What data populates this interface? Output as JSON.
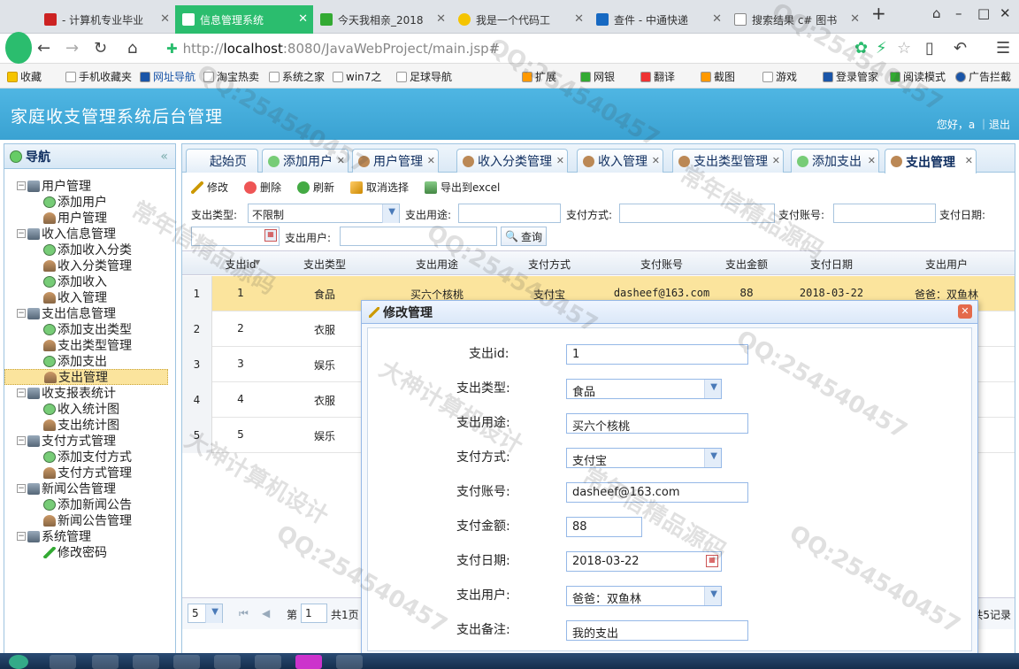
{
  "browser": {
    "tabs": [
      {
        "label": "- 计算机专业毕业"
      },
      {
        "label": "信息管理系统"
      },
      {
        "label": "今天我相亲_2018"
      },
      {
        "label": "我是一个代码工"
      },
      {
        "label": "查件 - 中通快递"
      },
      {
        "label": "搜索结果 c# 图书"
      }
    ],
    "url_prefix": "http://",
    "url_host": "localhost",
    "url_rest": ":8080/JavaWebProject/main.jsp#",
    "bookmarks": [
      "收藏",
      "手机收藏夹",
      "网址导航",
      "淘宝热卖",
      "系统之家",
      "win7之",
      "足球导航"
    ],
    "extensions": [
      "扩展",
      "网银",
      "翻译",
      "截图",
      "游戏",
      "登录管家",
      "阅读模式",
      "广告拦截"
    ]
  },
  "app": {
    "title": "家庭收支管理系统后台管理",
    "greeting": "您好，a ｜退出"
  },
  "nav": {
    "title": "导航",
    "items": [
      {
        "label": "用户管理"
      },
      {
        "label": "添加用户"
      },
      {
        "label": "用户管理"
      },
      {
        "label": "收入信息管理"
      },
      {
        "label": "添加收入分类"
      },
      {
        "label": "收入分类管理"
      },
      {
        "label": "添加收入"
      },
      {
        "label": "收入管理"
      },
      {
        "label": "支出信息管理"
      },
      {
        "label": "添加支出类型"
      },
      {
        "label": "支出类型管理"
      },
      {
        "label": "添加支出"
      },
      {
        "label": "支出管理"
      },
      {
        "label": "收支报表统计"
      },
      {
        "label": "收入统计图"
      },
      {
        "label": "支出统计图"
      },
      {
        "label": "支付方式管理"
      },
      {
        "label": "添加支付方式"
      },
      {
        "label": "支付方式管理"
      },
      {
        "label": "新闻公告管理"
      },
      {
        "label": "添加新闻公告"
      },
      {
        "label": "新闻公告管理"
      },
      {
        "label": "系统管理"
      },
      {
        "label": "修改密码"
      }
    ]
  },
  "tabs": [
    {
      "label": "起始页"
    },
    {
      "label": "添加用户"
    },
    {
      "label": "用户管理"
    },
    {
      "label": "收入分类管理"
    },
    {
      "label": "收入管理"
    },
    {
      "label": "支出类型管理"
    },
    {
      "label": "添加支出"
    },
    {
      "label": "支出管理"
    }
  ],
  "toolbar": {
    "edit": "修改",
    "delete": "删除",
    "refresh": "刷新",
    "cancel": "取消选择",
    "export": "导出到excel"
  },
  "filter": {
    "type_label": "支出类型:",
    "type_value": "不限制",
    "purpose_label": "支出用途:",
    "method_label": "支付方式:",
    "account_label": "支付账号:",
    "date_label": "支付日期:",
    "user_label": "支出用户:",
    "query": "查询"
  },
  "grid": {
    "headers": [
      "支出id",
      "支出类型",
      "支出用途",
      "支付方式",
      "支付账号",
      "支出金额",
      "支付日期",
      "支出用户"
    ],
    "rows": [
      {
        "n": "1",
        "id": "1",
        "type": "食品",
        "purpose": "买六个核桃",
        "method": "支付宝",
        "account": "dasheef@163.com",
        "amount": "88",
        "date": "2018-03-22",
        "user": "爸爸：双鱼林"
      },
      {
        "n": "2",
        "id": "2",
        "type": "衣服"
      },
      {
        "n": "3",
        "id": "3",
        "type": "娱乐"
      },
      {
        "n": "4",
        "id": "4",
        "type": "衣服"
      },
      {
        "n": "5",
        "id": "5",
        "type": "娱乐"
      }
    ]
  },
  "pager": {
    "page_size": "5",
    "page_label": "第",
    "page_value": "1",
    "total_pages": "共1页",
    "total_records": "共5记录"
  },
  "dialog": {
    "title": "修改管理",
    "fields": [
      {
        "label": "支出id:",
        "value": "1"
      },
      {
        "label": "支出类型:",
        "value": "食品"
      },
      {
        "label": "支出用途:",
        "value": "买六个核桃"
      },
      {
        "label": "支付方式:",
        "value": "支付宝"
      },
      {
        "label": "支付账号:",
        "value": "dasheef@163.com"
      },
      {
        "label": "支付金额:",
        "value": "88"
      },
      {
        "label": "支付日期:",
        "value": "2018-03-22"
      },
      {
        "label": "支出用户:",
        "value": "爸爸：双鱼林"
      },
      {
        "label": "支出备注:",
        "value": "我的支出"
      }
    ]
  },
  "watermarks": [
    "QQ:254540457",
    "大神计算机设计",
    "常年信精品源码"
  ]
}
